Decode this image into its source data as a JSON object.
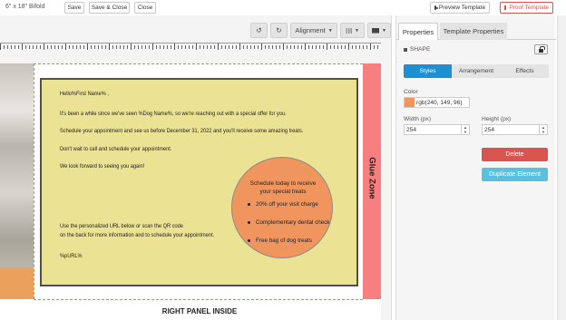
{
  "header": {
    "doc_size": "6\" x 18\" Bifold",
    "save_label": "Save",
    "save_close_label": "Save & Close",
    "close_label": "Close",
    "preview_label": "Preview Template",
    "proof_label": "Proof Template"
  },
  "canvas_toolbar": {
    "alignment_label": "Alignment",
    "undo_icon": "undo-icon",
    "redo_icon": "redo-icon",
    "grid_icon": "grid-icon",
    "mail_icon": "mail-icon"
  },
  "design": {
    "hello": "Hello%First Name% ,",
    "line1": "It's been a while since we've seen %Dog Name%, so we're reaching out with a special offer for you.",
    "line2": "Schedule your appointment and see us before December 31, 2022 and you'll receive some amazing treats.",
    "line3": "Don't wait to call and schedule your appointment.",
    "line4": "We look forward to seeing you again!",
    "url_line1": "Use the personalized URL below or scan the QR code",
    "url_line2": "on the back for more information and to schedule your appointment.",
    "purl": "%pURL%",
    "circle_title_1": "Schedule today to receive",
    "circle_title_2": "your special treats",
    "offers": [
      "20% off your visit charge",
      "Complementary dental check",
      "Free bag of dog treats"
    ],
    "glue_zone": "Glue Zone",
    "page_label": "RIGHT PANEL INSIDE",
    "panel_color": "#ece294",
    "circle_color": "#f0955e",
    "glue_color": "#f77f7f"
  },
  "properties": {
    "tabs": [
      "Properties",
      "Template Properties"
    ],
    "shape_label": "SHAPE",
    "subtabs": [
      "Styles",
      "Arrangement",
      "Effects"
    ],
    "color_label": "Color",
    "color_value": "rgb(240, 149, 96)",
    "width_label": "Width (px)",
    "width_value": "254",
    "height_label": "Height (px)",
    "height_value": "254",
    "delete_label": "Delete",
    "duplicate_label": "Duplicate Element",
    "accent": "#1f8fd4",
    "danger": "#d9534f",
    "info": "#5bc0de"
  }
}
